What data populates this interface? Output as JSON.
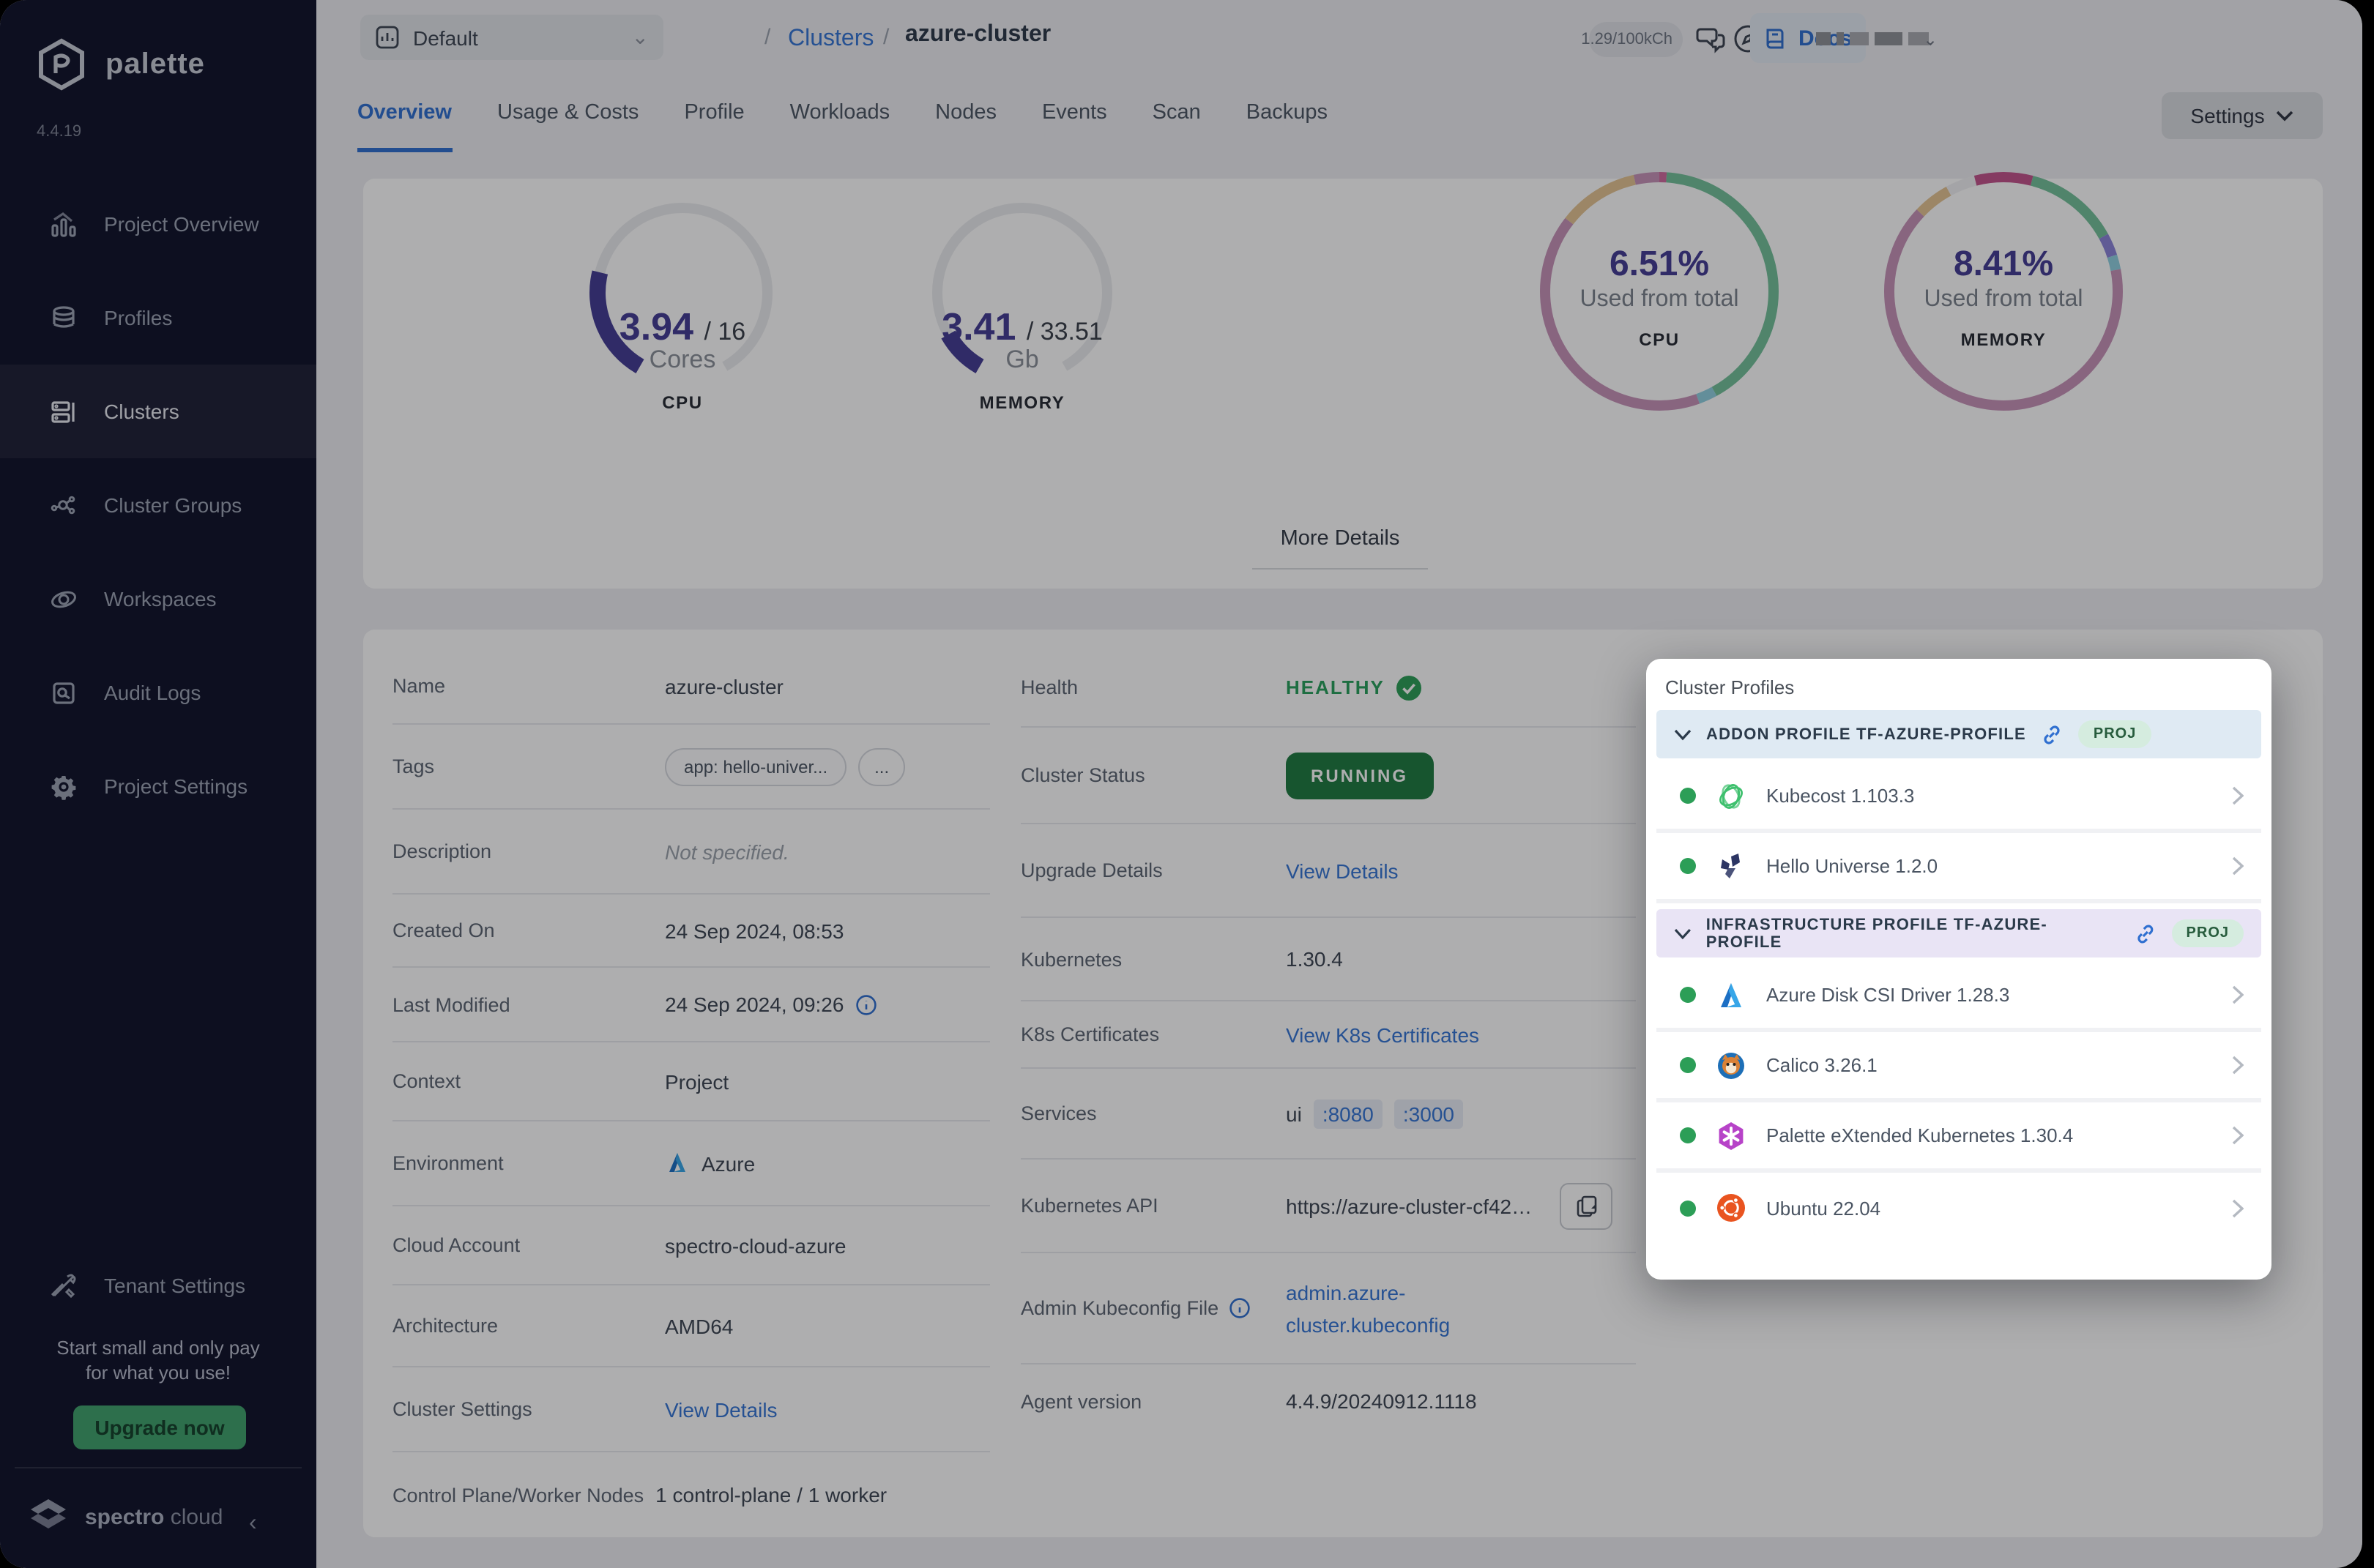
{
  "app": {
    "brand": "palette",
    "version": "4.4.19",
    "footer_brand_bold": "spectro",
    "footer_brand_light": "cloud"
  },
  "sidebar": {
    "items": [
      {
        "label": "Project Overview"
      },
      {
        "label": "Profiles"
      },
      {
        "label": "Clusters",
        "active": true
      },
      {
        "label": "Cluster Groups"
      },
      {
        "label": "Workspaces"
      },
      {
        "label": "Audit Logs"
      },
      {
        "label": "Project Settings"
      }
    ],
    "tenant_settings": "Tenant Settings",
    "promo_line1": "Start small and only pay",
    "promo_line2": "for what you use!",
    "upgrade_button": "Upgrade now"
  },
  "topbar": {
    "project_selector": "Default",
    "breadcrumb_sep": "/",
    "breadcrumb_parent": "Clusters",
    "breadcrumb_current": "azure-cluster",
    "usage_pill": "1.29/100kCh",
    "docs_button": "Docs"
  },
  "tabs": {
    "items": [
      "Overview",
      "Usage & Costs",
      "Profile",
      "Workloads",
      "Nodes",
      "Events",
      "Scan",
      "Backups"
    ],
    "active": "Overview",
    "settings_button": "Settings"
  },
  "chart_data": [
    {
      "type": "gauge",
      "title": "CPU",
      "value": 3.94,
      "max": 16,
      "display_value": "3.94",
      "display_max": "/ 16",
      "unit": "Cores",
      "label": "CPU",
      "color": "#443c94",
      "track_color": "#ebecef",
      "arc_degrees": 300
    },
    {
      "type": "gauge",
      "title": "MEMORY",
      "value": 3.41,
      "max": 33.51,
      "display_value": "3.41",
      "display_max": "/ 33.51",
      "unit": "Gb",
      "label": "MEMORY",
      "color": "#443c94",
      "track_color": "#ebecef",
      "arc_degrees": 300
    },
    {
      "type": "donut",
      "title": "CPU usage donut",
      "percent_label": "6.51%",
      "sub_label": "Used from total",
      "label": "CPU",
      "segments": [
        {
          "color": "#d06a9e",
          "value": 1
        },
        {
          "color": "#74c09a",
          "value": 41
        },
        {
          "color": "#8fd0e0",
          "value": 2.5
        },
        {
          "color": "#c792b8",
          "value": 41
        },
        {
          "color": "#e4c492",
          "value": 11
        },
        {
          "color": "#c792b8",
          "value": 3.5
        }
      ]
    },
    {
      "type": "donut",
      "title": "Memory usage donut",
      "percent_label": "8.41%",
      "sub_label": "Used from total",
      "label": "MEMORY",
      "segments": [
        {
          "color": "#c2538b",
          "value": 4
        },
        {
          "color": "#74c09a",
          "value": 13
        },
        {
          "color": "#8b83d8",
          "value": 3
        },
        {
          "color": "#8fd0e0",
          "value": 2
        },
        {
          "color": "#c792b8",
          "value": 65
        },
        {
          "color": "#e4c492",
          "value": 5
        },
        {
          "color": "#f1f1f3",
          "value": 4
        },
        {
          "color": "#c2538b",
          "value": 4
        }
      ]
    }
  ],
  "charts_card": {
    "more_details": "More Details"
  },
  "details": {
    "left": [
      {
        "label": "Name",
        "value": "azure-cluster"
      },
      {
        "label": "Tags",
        "tag": "app: hello-univer...",
        "more": "..."
      },
      {
        "label": "Description",
        "value": "Not specified."
      },
      {
        "label": "Created On",
        "value": "24 Sep 2024, 08:53"
      },
      {
        "label": "Last Modified",
        "value": "24 Sep 2024, 09:26"
      },
      {
        "label": "Context",
        "value": "Project"
      },
      {
        "label": "Environment",
        "value": "Azure"
      },
      {
        "label": "Cloud Account",
        "value": "spectro-cloud-azure"
      },
      {
        "label": "Architecture",
        "value": "AMD64"
      },
      {
        "label": "Cluster Settings",
        "value": "View Details"
      },
      {
        "label": "Control Plane/Worker Nodes",
        "value": "1 control-plane / 1 worker"
      }
    ],
    "right": [
      {
        "label": "Health",
        "value": "HEALTHY"
      },
      {
        "label": "Cluster Status",
        "value": "RUNNING"
      },
      {
        "label": "Upgrade Details",
        "value": "View Details"
      },
      {
        "label": "Kubernetes",
        "value": "1.30.4"
      },
      {
        "label": "K8s Certificates",
        "value": "View K8s Certificates"
      },
      {
        "label": "Services",
        "value": "ui",
        "port1": ":8080",
        "port2": ":3000"
      },
      {
        "label": "Kubernetes API",
        "value": "https://azure-cluster-cf42…"
      },
      {
        "label": "Admin Kubeconfig File",
        "value": "admin.azure-cluster.kubeconfig"
      },
      {
        "label": "Agent version",
        "value": "4.4.9/20240912.1118"
      }
    ]
  },
  "popup": {
    "title": "Cluster Profiles",
    "sections": [
      {
        "header": "ADDON PROFILE TF-AZURE-PROFILE",
        "badge": "PROJ",
        "items": [
          {
            "name": "Kubecost 1.103.3"
          },
          {
            "name": "Hello Universe 1.2.0"
          }
        ]
      },
      {
        "header": "INFRASTRUCTURE PROFILE TF-AZURE-PROFILE",
        "badge": "PROJ",
        "items": [
          {
            "name": "Azure Disk CSI Driver 1.28.3"
          },
          {
            "name": "Calico 3.26.1"
          },
          {
            "name": "Palette eXtended Kubernetes 1.30.4"
          },
          {
            "name": "Ubuntu 22.04"
          }
        ]
      }
    ]
  }
}
